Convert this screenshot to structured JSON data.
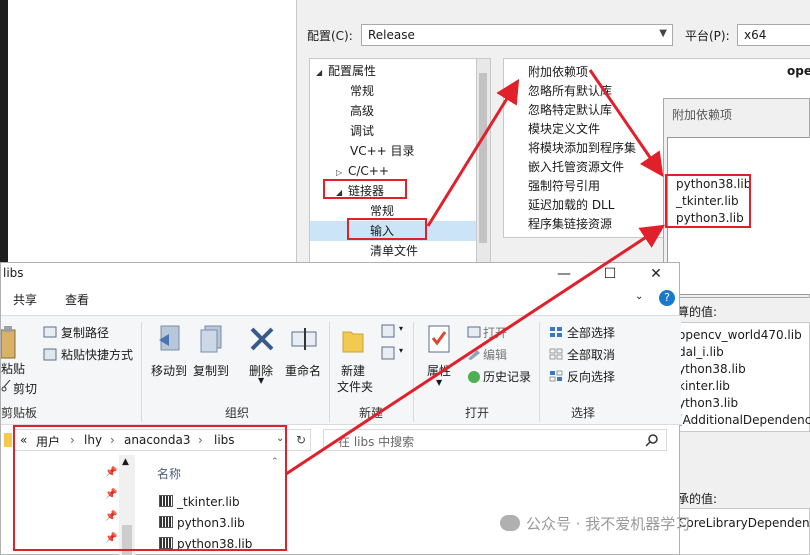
{
  "vs_dialog": {
    "config_label": "配置(C):",
    "config_value": "Release",
    "platform_label": "平台(P):",
    "platform_value": "x64",
    "tree": [
      {
        "label": "配置属性",
        "indent": 0,
        "tri": "◢"
      },
      {
        "label": "常规",
        "indent": 2,
        "tri": ""
      },
      {
        "label": "高级",
        "indent": 2,
        "tri": ""
      },
      {
        "label": "调试",
        "indent": 2,
        "tri": ""
      },
      {
        "label": "VC++ 目录",
        "indent": 2,
        "tri": ""
      },
      {
        "label": "C/C++",
        "indent": 1,
        "tri": "▷"
      },
      {
        "label": "链接器",
        "indent": 1,
        "tri": "◢"
      },
      {
        "label": "常规",
        "indent": 3,
        "tri": ""
      },
      {
        "label": "输入",
        "indent": 3,
        "tri": ""
      },
      {
        "label": "清单文件",
        "indent": 3,
        "tri": ""
      }
    ],
    "props": [
      "附加依赖项",
      "忽略所有默认库",
      "忽略特定默认库",
      "模块定义文件",
      "将模块添加到程序集",
      "嵌入托管资源文件",
      "强制符号引用",
      "延迟加载的 DLL",
      "程序集链接资源"
    ],
    "prop_value": "ope",
    "calc_label": "算的值:",
    "calc_values": [
      "opencv_world470.lib",
      "dal_i.lib",
      "ython38.lib",
      "kinter.lib",
      "ython3.lib",
      "(AdditionalDependenc"
    ],
    "inherited_label": "承的值:",
    "inherited_values": [
      "CoreLibraryDependen"
    ]
  },
  "popup": {
    "title": "附加依赖项",
    "lines": [
      "python38.lib",
      "_tkinter.lib",
      "python3.lib"
    ]
  },
  "explorer": {
    "title": "libs",
    "minimize": "—",
    "maximize": "☐",
    "close": "✕",
    "tabs": [
      "共享",
      "查看"
    ],
    "help_icon": "?",
    "ribbon": {
      "copy_path": "复制路径",
      "paste_shortcut": "粘贴快捷方式",
      "paste": "粘贴",
      "cut": "剪切",
      "move_to": "移动到",
      "copy_to": "复制到",
      "delete": "删除",
      "rename": "重命名",
      "new_folder": "新建\n文件夹",
      "new_folder_l1": "新建",
      "new_folder_l2": "文件夹",
      "properties": "属性",
      "open": "打开",
      "edit": "编辑",
      "history": "历史记录",
      "select_all": "全部选择",
      "select_none": "全部取消",
      "invert": "反向选择",
      "groups": {
        "clipboard": "剪贴板",
        "organize": "组织",
        "new": "新建",
        "open": "打开",
        "select": "选择"
      }
    },
    "address": [
      "«",
      "用户",
      "lhy",
      "anaconda3",
      "libs"
    ],
    "search_placeholder": "在 libs 中搜索",
    "column_name": "名称",
    "files": [
      "_tkinter.lib",
      "python3.lib",
      "python38.lib"
    ]
  },
  "watermark": "公众号 · 我不爱机器学习",
  "colors": {
    "annotation_red": "#e0202a",
    "selection": "#cce4f7"
  }
}
